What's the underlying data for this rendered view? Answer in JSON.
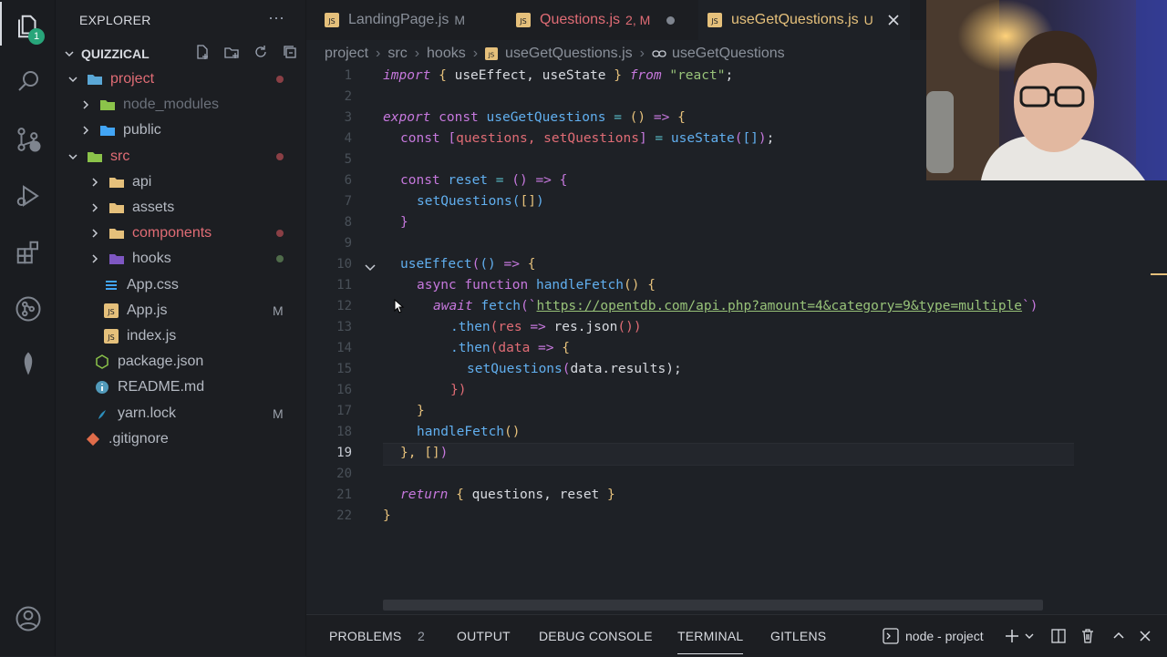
{
  "activity_bar": {
    "explorer_badge": "1"
  },
  "sidebar": {
    "header": "EXPLORER",
    "more": "···",
    "root": "QUIZZICAL",
    "items": [
      {
        "label": "project",
        "kind": "folder-open",
        "color": "#e06c75",
        "status": "dot-red"
      },
      {
        "label": "node_modules",
        "kind": "folder",
        "color": "#6b717b",
        "status": ""
      },
      {
        "label": "public",
        "kind": "folder",
        "color": "#b4b9c2",
        "status": ""
      },
      {
        "label": "src",
        "kind": "folder-open",
        "color": "#e06c75",
        "status": "dot-red"
      },
      {
        "label": "api",
        "kind": "folder",
        "color": "#b4b9c2",
        "status": ""
      },
      {
        "label": "assets",
        "kind": "folder",
        "color": "#b4b9c2",
        "status": ""
      },
      {
        "label": "components",
        "kind": "folder",
        "color": "#e06c75",
        "status": "dot-red"
      },
      {
        "label": "hooks",
        "kind": "folder",
        "color": "#b4b9c2",
        "status": "dot-green"
      },
      {
        "label": "App.css",
        "kind": "css",
        "color": "#b4b9c2",
        "status": ""
      },
      {
        "label": "App.js",
        "kind": "js",
        "color": "#b4b9c2",
        "status": "M"
      },
      {
        "label": "index.js",
        "kind": "js",
        "color": "#b4b9c2",
        "status": ""
      },
      {
        "label": "package.json",
        "kind": "json",
        "color": "#b4b9c2",
        "status": ""
      },
      {
        "label": "README.md",
        "kind": "info",
        "color": "#b4b9c2",
        "status": ""
      },
      {
        "label": "yarn.lock",
        "kind": "yarn",
        "color": "#b4b9c2",
        "status": "M"
      },
      {
        "label": ".gitignore",
        "kind": "git",
        "color": "#b4b9c2",
        "status": ""
      }
    ]
  },
  "tabs": [
    {
      "label": "LandingPage.js",
      "flag": "M",
      "color": "#8a909a"
    },
    {
      "label": "Questions.js",
      "flag": "2, M",
      "color": "#e06c75"
    },
    {
      "label": "useGetQuestions.js",
      "flag": "U",
      "color": "#e5c07b"
    }
  ],
  "breadcrumb": [
    "project",
    "src",
    "hooks",
    "useGetQuestions.js",
    "useGetQuestions"
  ],
  "line_numbers": [
    "1",
    "2",
    "3",
    "4",
    "5",
    "6",
    "7",
    "8",
    "9",
    "10",
    "11",
    "12",
    "13",
    "14",
    "15",
    "16",
    "17",
    "18",
    "19",
    "20",
    "21",
    "22"
  ],
  "code": {
    "l1": [
      "import",
      "{",
      "useEffect,",
      "useState",
      "}",
      "from",
      "\"react\"",
      ";"
    ],
    "l3": [
      "export",
      "const",
      "useGetQuestions",
      "=",
      "()",
      "=>",
      "{"
    ],
    "l4": [
      "const",
      "[",
      "questions,",
      "setQuestions",
      "]",
      "=",
      "useState",
      "(",
      "[]",
      ")",
      ";"
    ],
    "l6": [
      "const",
      "reset",
      "=",
      "()",
      "=>",
      "{"
    ],
    "l7": [
      "setQuestions",
      "(",
      "[]",
      ")"
    ],
    "l8": [
      "}"
    ],
    "l10": [
      "useEffect",
      "(",
      "()",
      "=>",
      "{"
    ],
    "l11": [
      "async",
      "function",
      "handleFetch",
      "()",
      "{"
    ],
    "l12": [
      "await",
      "fetch",
      "(`",
      "https://opentdb.com/api.php?amount=4&category=9&type=multiple",
      "`)"
    ],
    "l13": [
      ".then",
      "(",
      "res",
      "=>",
      "res.json",
      "())"
    ],
    "l14": [
      ".then",
      "(",
      "data",
      "=>",
      "{"
    ],
    "l15": [
      "setQuestions",
      "(",
      "data.results",
      ");"
    ],
    "l16": [
      "})"
    ],
    "l17": [
      "}"
    ],
    "l18": [
      "handleFetch",
      "()"
    ],
    "l19": [
      "},",
      "[]",
      ")"
    ],
    "l21": [
      "return",
      "{",
      "questions,",
      "reset",
      "}"
    ],
    "l22": [
      "}"
    ]
  },
  "panel": {
    "tabs": [
      "PROBLEMS",
      "OUTPUT",
      "DEBUG CONSOLE",
      "TERMINAL",
      "GITLENS"
    ],
    "problems_count": "2",
    "terminal_name": "node - project"
  }
}
